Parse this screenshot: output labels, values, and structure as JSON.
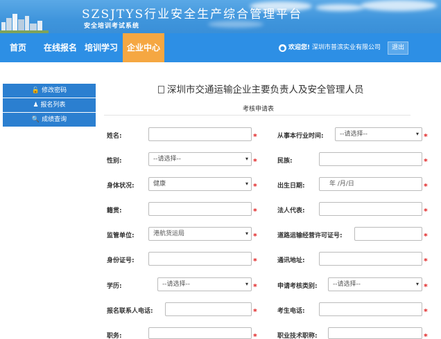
{
  "banner": {
    "title": "SZSJTYS行业安全生产综合管理平台",
    "subtitle": "安全培训考试系统"
  },
  "nav": {
    "items": [
      "首页",
      "在线报名",
      "培训学习",
      "企业中心"
    ],
    "active": "企业中心",
    "welcome_label": "欢迎您!",
    "company": "深圳市普滨实业有限公司",
    "logout": "退出"
  },
  "sidebar": {
    "items": [
      {
        "label": "修改密码",
        "icon": "lock-icon"
      },
      {
        "label": "报名列表",
        "icon": "user-icon"
      },
      {
        "label": "成绩查询",
        "icon": "search-icon"
      }
    ]
  },
  "form": {
    "title": "深圳市交通运输企业主要负责人及安全管理人员",
    "subtitle": "考核申请表",
    "fields": {
      "name": {
        "label": "姓名:",
        "value": ""
      },
      "work_start": {
        "label": "从事本行业时间:",
        "value": "--请选择--"
      },
      "gender": {
        "label": "性别:",
        "value": "--请选择--"
      },
      "ethnicity": {
        "label": "民族:",
        "value": ""
      },
      "health": {
        "label": "身体状况:",
        "value": "健康"
      },
      "birth": {
        "label": "出生日期:",
        "value": "年 /月/日"
      },
      "native_place": {
        "label": "籍贯:",
        "value": ""
      },
      "legal_rep": {
        "label": "法人代表:",
        "value": ""
      },
      "supervisor": {
        "label": "监管单位:",
        "value": "港航货运局"
      },
      "license_no": {
        "label": "道路运输经营许可证号:",
        "value": ""
      },
      "id_no": {
        "label": "身份证号:",
        "value": ""
      },
      "address": {
        "label": "通讯地址:",
        "value": ""
      },
      "education": {
        "label": "学历:",
        "value": "--请选择--"
      },
      "exam_type": {
        "label": "申请考核类别:",
        "value": "--请选择--"
      },
      "contact_phone": {
        "label": "报名联系人电话:",
        "value": ""
      },
      "candidate_phone": {
        "label": "考生电话:",
        "value": ""
      },
      "position": {
        "label": "职务:",
        "value": ""
      },
      "tech_title": {
        "label": "职业技术职称:",
        "value": ""
      }
    },
    "required_mark": "*"
  },
  "colors": {
    "nav_bg": "#2d8fe5",
    "nav_active": "#f5a742",
    "sidebar_bg": "#2b7fd0",
    "required": "#e02020"
  }
}
